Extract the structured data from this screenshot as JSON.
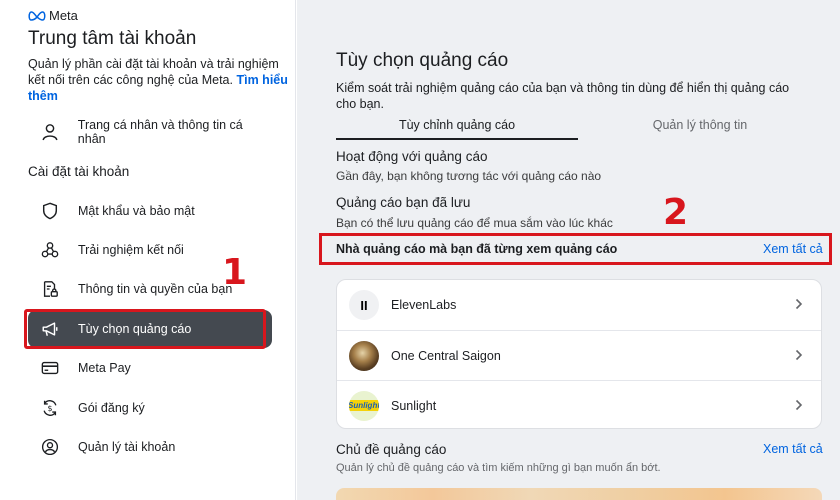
{
  "sidebar": {
    "logo_text": "Meta",
    "title": "Trung tâm tài khoản",
    "description": "Quản lý phần cài đặt tài khoản và trải nghiệm kết nối trên các công nghệ của Meta.",
    "learn_more": "Tìm hiểu thêm",
    "profile_item": "Trang cá nhân và thông tin cá nhân",
    "section_label": "Cài đặt tài khoản",
    "items": [
      {
        "label": "Mật khẩu và bảo mật",
        "icon": "shield-icon"
      },
      {
        "label": "Trải nghiệm kết nối",
        "icon": "connected-icon"
      },
      {
        "label": "Thông tin và quyền của bạn",
        "icon": "document-lock-icon"
      },
      {
        "label": "Tùy chọn quảng cáo",
        "icon": "megaphone-icon",
        "active": true
      },
      {
        "label": "Meta Pay",
        "icon": "card-icon"
      },
      {
        "label": "Gói đăng ký",
        "icon": "subscription-icon"
      },
      {
        "label": "Quản lý tài khoản",
        "icon": "account-circle-icon"
      }
    ]
  },
  "annotations": {
    "marker_1": "1",
    "marker_2": "2",
    "color": "#d8161d"
  },
  "main": {
    "title": "Tùy chọn quảng cáo",
    "description": "Kiểm soát trải nghiệm quảng cáo của bạn và thông tin dùng để hiển thị quảng cáo cho bạn.",
    "tabs": [
      {
        "label": "Tùy chỉnh quảng cáo",
        "active": true
      },
      {
        "label": "Quản lý thông tin",
        "active": false
      }
    ],
    "activity": {
      "heading": "Hoạt động với quảng cáo",
      "sub": "Gần đây, bạn không tương tác với quảng cáo nào"
    },
    "saved": {
      "heading": "Quảng cáo bạn đã lưu",
      "sub": "Bạn có thể lưu quảng cáo để mua sắm vào lúc khác"
    },
    "advertisers": {
      "heading": "Nhà quảng cáo mà bạn đã từng xem quảng cáo",
      "see_all": "Xem tất cả",
      "list": [
        {
          "name": "ElevenLabs",
          "avatar_text": "II"
        },
        {
          "name": "One Central Saigon",
          "avatar_text": ""
        },
        {
          "name": "Sunlight",
          "avatar_text": "Sunlight"
        }
      ]
    },
    "topics": {
      "heading": "Chủ đề quảng cáo",
      "see_all": "Xem tất cả",
      "sub": "Quản lý chủ đề quảng cáo và tìm kiếm những gì bạn muốn ẩn bớt."
    }
  },
  "colors": {
    "accent_blue": "#0064e0",
    "active_item_bg": "#444950",
    "annotation_red": "#d8161d"
  }
}
